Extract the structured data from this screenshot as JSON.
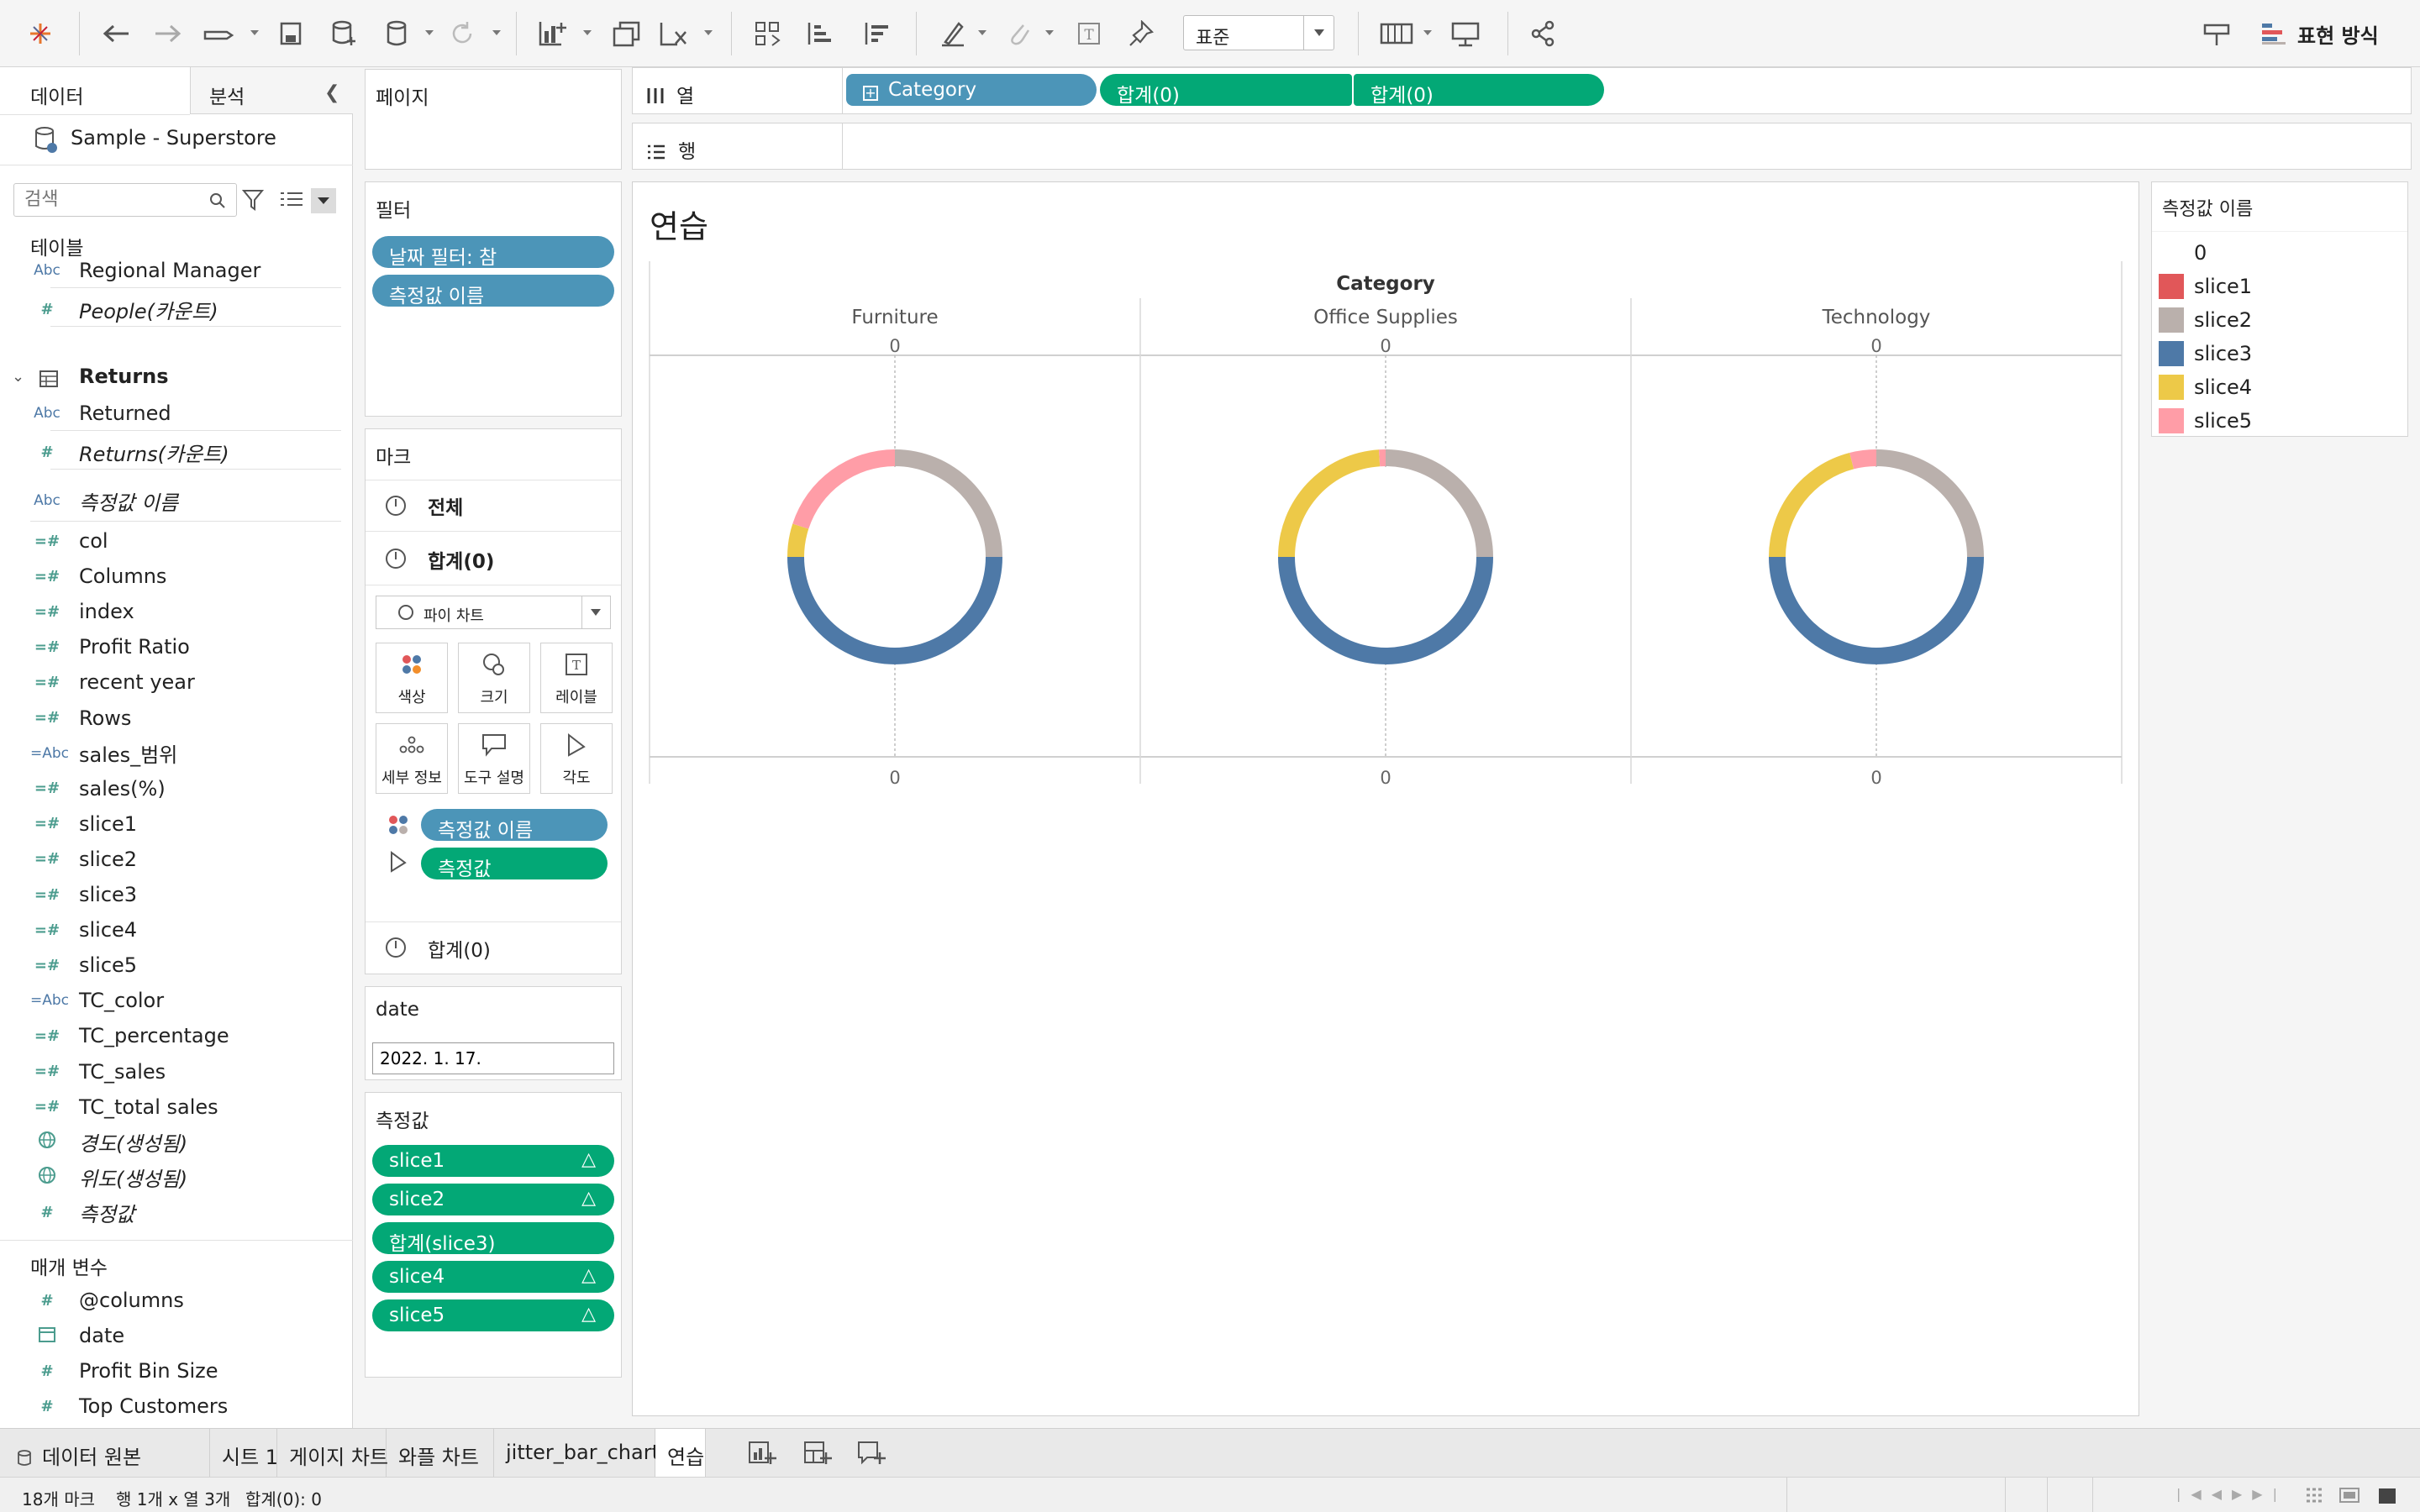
{
  "toolbar": {
    "format_select": "표준",
    "show_me": "표현 방식"
  },
  "data_pane": {
    "tab_data": "데이터",
    "tab_analysis": "분석",
    "datasource": "Sample - Superstore",
    "search_placeholder": "검색",
    "tables_header": "테이블",
    "fields_top": [
      {
        "icon": "Abc",
        "name": "Regional Manager"
      },
      {
        "icon": "#",
        "name": "People(카운트)"
      }
    ],
    "returns_header": "Returns",
    "returns_fields": [
      {
        "icon": "Abc",
        "name": "Returned"
      },
      {
        "icon": "#",
        "name": "Returns(카운트)"
      }
    ],
    "measure_names": "측정값 이름",
    "fields": [
      {
        "icon": "=#",
        "name": "col"
      },
      {
        "icon": "=#",
        "name": "Columns"
      },
      {
        "icon": "=#",
        "name": "index"
      },
      {
        "icon": "=#",
        "name": "Profit Ratio"
      },
      {
        "icon": "=#",
        "name": "recent year"
      },
      {
        "icon": "=#",
        "name": "Rows"
      },
      {
        "icon": "=Abc",
        "name": "sales_범위"
      },
      {
        "icon": "=#",
        "name": "sales(%)"
      },
      {
        "icon": "=#",
        "name": "slice1"
      },
      {
        "icon": "=#",
        "name": "slice2"
      },
      {
        "icon": "=#",
        "name": "slice3"
      },
      {
        "icon": "=#",
        "name": "slice4"
      },
      {
        "icon": "=#",
        "name": "slice5"
      },
      {
        "icon": "=Abc",
        "name": "TC_color"
      },
      {
        "icon": "=#",
        "name": "TC_percentage"
      },
      {
        "icon": "=#",
        "name": "TC_sales"
      },
      {
        "icon": "=#",
        "name": "TC_total sales"
      },
      {
        "icon": "globe",
        "name": "경도(생성됨)"
      },
      {
        "icon": "globe",
        "name": "위도(생성됨)"
      },
      {
        "icon": "#",
        "name": "측정값"
      }
    ],
    "params_header": "매개 변수",
    "params": [
      {
        "icon": "#",
        "name": "@columns"
      },
      {
        "icon": "cal",
        "name": "date"
      },
      {
        "icon": "#",
        "name": "Profit Bin Size"
      },
      {
        "icon": "#",
        "name": "Top Customers"
      }
    ]
  },
  "pages": {
    "title": "페이지"
  },
  "filters": {
    "title": "필터",
    "items": [
      "날짜 필터: 참",
      "측정값 이름"
    ]
  },
  "marks": {
    "title": "마크",
    "all": "전체",
    "sum1": "합계(0)",
    "type": "파이 차트",
    "buttons": [
      "색상",
      "크기",
      "레이블",
      "세부 정보",
      "도구 설명",
      "각도"
    ],
    "color_pill": "측정값 이름",
    "angle_pill": "측정값",
    "sum2": "합계(0)"
  },
  "date_param": {
    "title": "date",
    "value": "2022. 1. 17."
  },
  "measure_values": {
    "title": "측정값",
    "items": [
      "slice1",
      "slice2",
      "합계(slice3)",
      "slice4",
      "slice5"
    ]
  },
  "columns_shelf": {
    "label": "열",
    "pills": [
      "Category",
      "합계(0)",
      "합계(0)"
    ]
  },
  "rows_shelf": {
    "label": "행"
  },
  "view": {
    "title": "연습",
    "header": "Category",
    "categories": [
      "Furniture",
      "Office Supplies",
      "Technology"
    ],
    "axis_zero": "0"
  },
  "legend": {
    "title": "측정값 이름",
    "items": [
      {
        "name": "0",
        "color": ""
      },
      {
        "name": "slice1",
        "color": "#e15759"
      },
      {
        "name": "slice2",
        "color": "#bab0ac"
      },
      {
        "name": "slice3",
        "color": "#4e79a7"
      },
      {
        "name": "slice4",
        "color": "#edc948"
      },
      {
        "name": "slice5",
        "color": "#ff9da7"
      }
    ]
  },
  "chart_data": {
    "type": "pie",
    "donut": true,
    "categories": [
      "Furniture",
      "Office Supplies",
      "Technology"
    ],
    "series_names": [
      "slice1",
      "slice2",
      "slice3",
      "slice4",
      "slice5"
    ],
    "colors": [
      "#e15759",
      "#bab0ac",
      "#4e79a7",
      "#edc948",
      "#ff9da7"
    ],
    "values": [
      [
        0,
        25,
        50,
        5,
        20
      ],
      [
        0,
        25,
        50,
        24,
        1
      ],
      [
        0,
        25,
        50,
        21,
        4
      ]
    ]
  },
  "sheet_tabs": [
    "데이터 원본",
    "시트 1",
    "게이지 차트",
    "와플 차트",
    "jitter_bar_chart",
    "연습"
  ],
  "status": {
    "marks": "18개 마크",
    "rows_cols": "행 1개 x 열 3개",
    "sum": "합계(0): 0"
  }
}
